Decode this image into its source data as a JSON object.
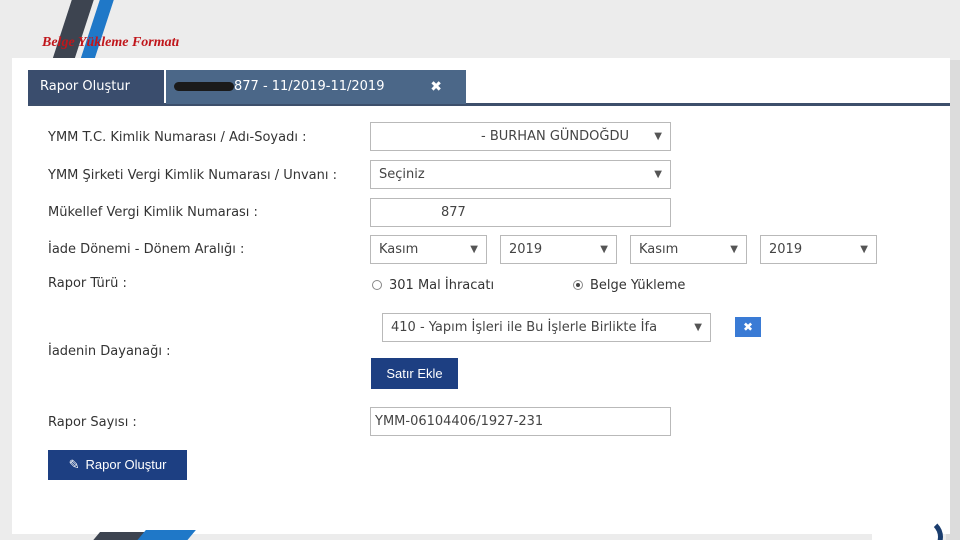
{
  "slide": {
    "title": "Belge Yükleme Formatı"
  },
  "tabs": {
    "active": "Rapor Oluştur",
    "second": "877 - 11/2019-11/2019"
  },
  "form": {
    "ymm_label": "YMM T.C. Kimlik Numarası / Adı-Soyadı :",
    "ymm_value": "- BURHAN GÜNDOĞDU",
    "sirket_label": "YMM Şirketi Vergi Kimlik Numarası / Unvanı :",
    "sirket_value": "Seçiniz",
    "mukellef_label": "Mükellef Vergi Kimlik Numarası :",
    "mukellef_value": "877",
    "donem_label": "İade Dönemi - Dönem Aralığı :",
    "donem_start_month": "Kasım",
    "donem_start_year": "2019",
    "donem_end_month": "Kasım",
    "donem_end_year": "2019",
    "rapor_turu_label": "Rapor Türü :",
    "radio_1": "301 Mal İhracatı",
    "radio_2": "Belge Yükleme",
    "dayanak_label": "İadenin Dayanağı :",
    "dayanak_value": "410 - Yapım İşleri ile Bu İşlerle Birlikte İfa",
    "satir_ekle": "Satır Ekle",
    "rapor_sayisi_label": "Rapor Sayısı :",
    "rapor_sayisi_value": "YMM-06104406/1927-231",
    "rapor_olustur": "Rapor Oluştur"
  },
  "colors": {
    "title_red": "#c0161b",
    "tab_dark": "#3a4d6d",
    "button_navy": "#1d3f82"
  }
}
